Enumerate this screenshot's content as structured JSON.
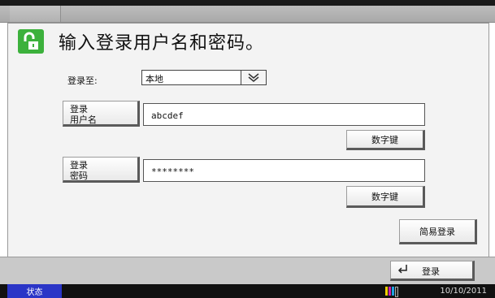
{
  "header": {
    "title": "输入登录用户名和密码。"
  },
  "login_to": {
    "label": "登录至:",
    "selected": "本地"
  },
  "username": {
    "button_line1": "登录",
    "button_line2": "用户名",
    "value": "abcdef",
    "keypad_label": "数字键"
  },
  "password": {
    "button_line1": "登录",
    "button_line2": "密码",
    "value": "********",
    "keypad_label": "数字键"
  },
  "simple_login_label": "简易登录",
  "login_button_label": "登录",
  "status": {
    "status_label": "状态",
    "date": "10/10/2011"
  },
  "colors": {
    "lock_icon": "#3cb13c",
    "status_button": "#2a35c7",
    "toner": [
      "#f0d000",
      "#d020b0",
      "#20a0e0",
      "#222222"
    ]
  }
}
